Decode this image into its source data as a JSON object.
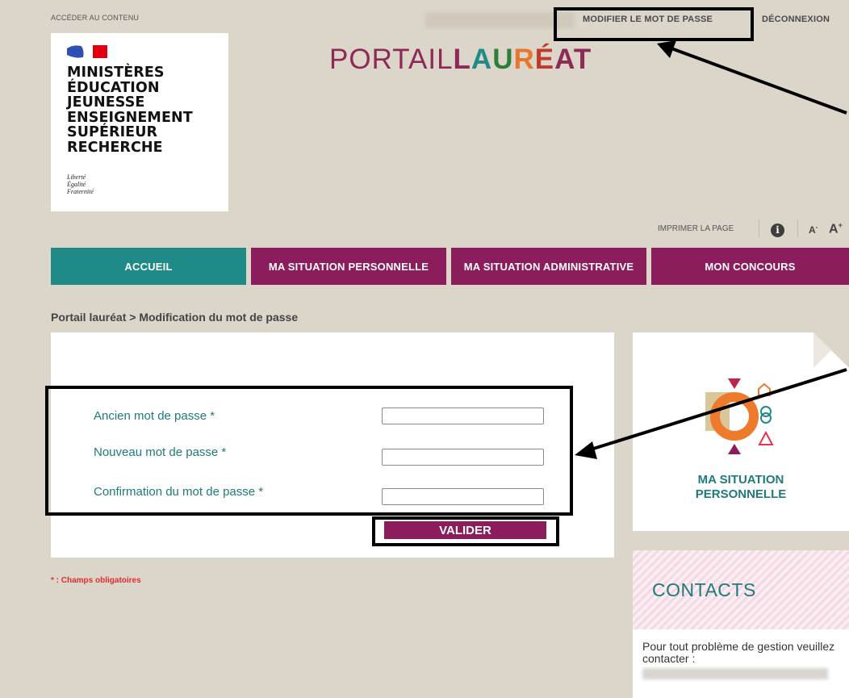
{
  "header": {
    "skip_link": "ACCÉDER AU CONTENU",
    "change_password_link": "MODIFIER LE MOT DE PASSE",
    "logout_link": "DÉCONNEXION"
  },
  "logo": {
    "lines": [
      "MINISTÈRES",
      "ÉDUCATION",
      "JEUNESSE",
      "ENSEIGNEMENT",
      "SUPÉRIEUR",
      "RECHERCHE"
    ],
    "motto": [
      "Liberté",
      "Égalité",
      "Fraternité"
    ]
  },
  "portal": {
    "title_part1": "PORTAIL",
    "title_letters": [
      "L",
      "A",
      "U",
      "R",
      "É",
      "A",
      "T"
    ]
  },
  "utility": {
    "print_label": "IMPRIMER LA PAGE",
    "info_icon": "info-icon",
    "font_decrease": "A",
    "font_decrease_sup": "-",
    "font_increase": "A",
    "font_increase_sup": "+"
  },
  "nav": {
    "tabs": [
      {
        "label": "ACCUEIL"
      },
      {
        "label": "MA SITUATION PERSONNELLE"
      },
      {
        "label": "MA SITUATION ADMINISTRATIVE"
      },
      {
        "label": "MON CONCOURS"
      }
    ]
  },
  "breadcrumb": "Portail lauréat > Modification du mot de passe",
  "form": {
    "old_password_label": "Ancien mot de passe *",
    "new_password_label": "Nouveau mot de passe *",
    "confirm_password_label": "Confirmation du mot de passe *",
    "submit_label": "VALIDER",
    "required_note": "* : Champs obligatoires"
  },
  "side": {
    "card_title_line1": "MA SITUATION",
    "card_title_line2": "PERSONNELLE",
    "contacts_title": "CONTACTS",
    "contacts_text": "Pour tout problème de gestion veuillez contacter :"
  },
  "colors": {
    "teal": "#1f8a86",
    "plum": "#8b1d5c",
    "beige": "#dcd6ca",
    "title_letters": [
      "#8e2a55",
      "#1f8a86",
      "#2f7d3a",
      "#e8762a",
      "#c0392b",
      "#8e2a55",
      "#8e2a55"
    ]
  }
}
